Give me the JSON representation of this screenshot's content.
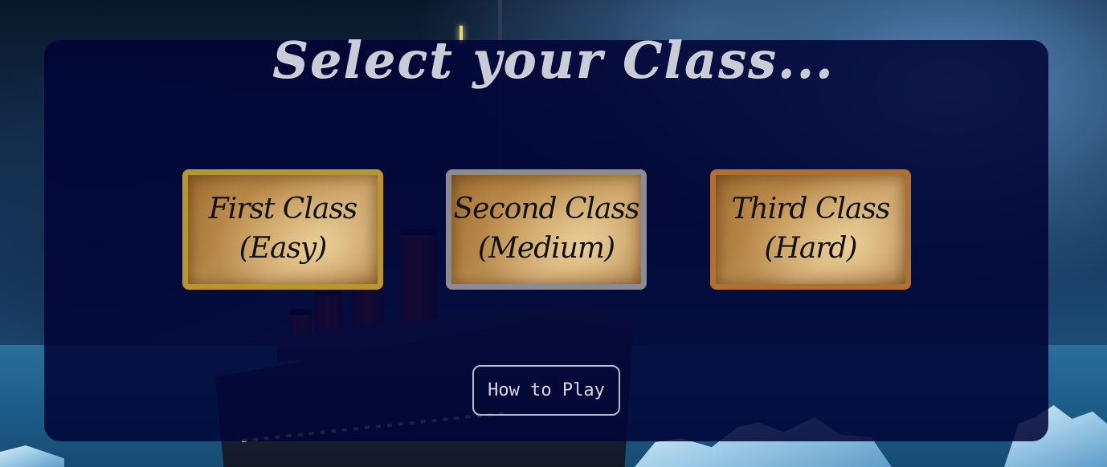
{
  "page": {
    "title": "Select your Class..."
  },
  "classes": [
    {
      "label": "First Class\n(Easy)",
      "border_color": "#b9962a"
    },
    {
      "label": "Second Class\n(Medium)",
      "border_color": "#8a8b93"
    },
    {
      "label": "Third Class\n(Hard)",
      "border_color": "#b1702f"
    }
  ],
  "how_to_play": {
    "label": "How to Play"
  },
  "colors": {
    "panel": "#000336",
    "title_text": "#c9ccd6"
  }
}
